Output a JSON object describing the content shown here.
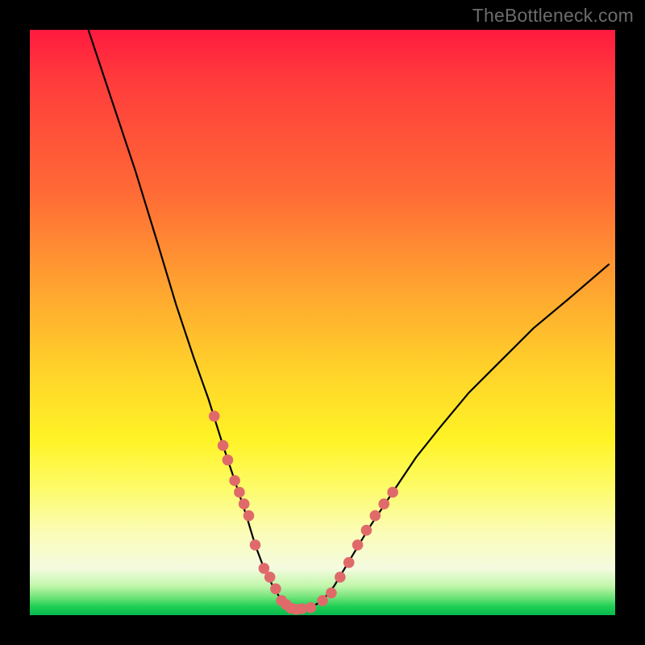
{
  "watermark": "TheBottleneck.com",
  "colors": {
    "background": "#000000",
    "gradient_top": "#ff1a3f",
    "gradient_mid": "#ffd22a",
    "gradient_bottom": "#09b84d",
    "curve_stroke": "#000000",
    "dot_fill": "#e06a6a"
  },
  "chart_data": {
    "type": "line",
    "title": "",
    "xlabel": "",
    "ylabel": "",
    "xlim": [
      0,
      100
    ],
    "ylim": [
      0,
      100
    ],
    "grid": false,
    "legend": false,
    "series": [
      {
        "name": "bottleneck-curve",
        "x": [
          10,
          14,
          18,
          22,
          25,
          28,
          30.5,
          33,
          35,
          37,
          38.5,
          40,
          41.5,
          43,
          44.5,
          46,
          48,
          50,
          52,
          55,
          58,
          62,
          66,
          70,
          75,
          80,
          86,
          92,
          99
        ],
        "y": [
          100,
          88,
          76,
          63,
          53,
          44,
          37,
          29,
          23,
          17,
          12,
          8,
          5,
          2.5,
          1.2,
          1.0,
          1.3,
          2.5,
          5,
          10,
          15,
          21,
          27,
          32,
          38,
          43,
          49,
          54,
          60
        ]
      }
    ],
    "highlight_dots": {
      "name": "sample-points",
      "x": [
        31.5,
        33,
        33.8,
        35,
        35.8,
        36.6,
        37.4,
        38.5,
        40,
        41,
        42,
        43,
        43.8,
        44.6,
        45.5,
        46.5,
        48,
        50,
        51.5,
        53,
        54.5,
        56,
        57.5,
        59,
        60.5,
        62
      ],
      "y": [
        34,
        29,
        26.5,
        23,
        21,
        19,
        17,
        12,
        8,
        6.5,
        4.5,
        2.5,
        1.8,
        1.2,
        1.0,
        1.1,
        1.3,
        2.5,
        3.8,
        6.5,
        9,
        12,
        14.5,
        17,
        19,
        21
      ]
    }
  }
}
